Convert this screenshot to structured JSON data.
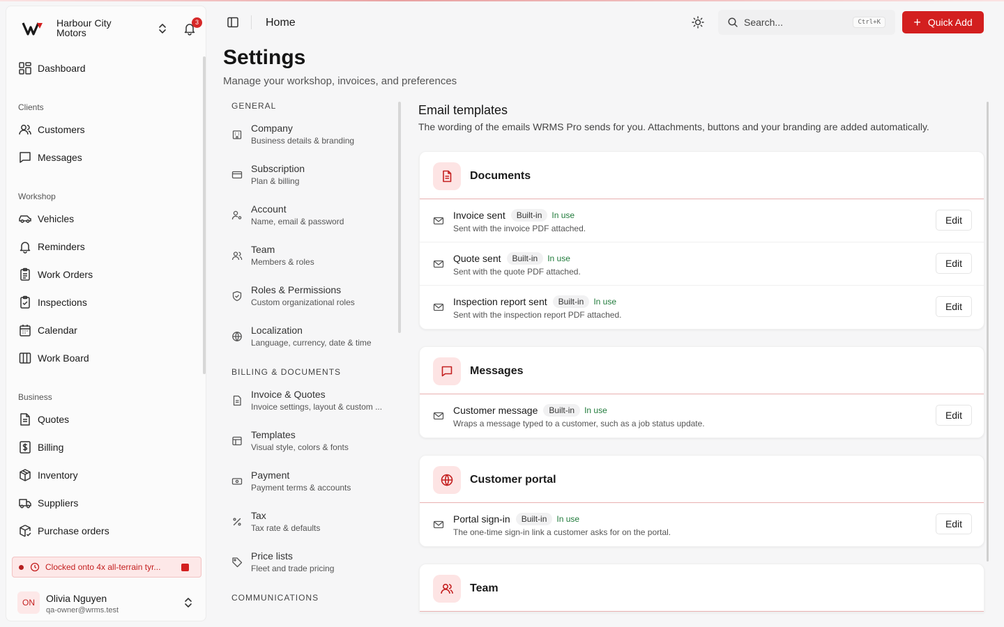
{
  "org": {
    "name": "Harbour City Motors",
    "notification_count": "3"
  },
  "sidebar": {
    "dashboard": "Dashboard",
    "sections": {
      "clients": "Clients",
      "workshop": "Workshop",
      "business": "Business"
    },
    "items": {
      "customers": "Customers",
      "messages": "Messages",
      "vehicles": "Vehicles",
      "reminders": "Reminders",
      "work_orders": "Work Orders",
      "inspections": "Inspections",
      "calendar": "Calendar",
      "work_board": "Work Board",
      "quotes": "Quotes",
      "billing": "Billing",
      "inventory": "Inventory",
      "suppliers": "Suppliers",
      "purchase_orders": "Purchase orders"
    },
    "clocked": "Clocked onto 4x all-terrain tyr...",
    "user": {
      "initials": "ON",
      "name": "Olivia Nguyen",
      "email": "qa-owner@wrms.test"
    }
  },
  "topbar": {
    "breadcrumb": "Home",
    "search_placeholder": "Search...",
    "shortcut": "Ctrl+K",
    "quick_add": "Quick Add"
  },
  "page": {
    "title": "Settings",
    "subtitle": "Manage your workshop, invoices, and preferences"
  },
  "settings_nav": {
    "general_label": "GENERAL",
    "general": [
      {
        "title": "Company",
        "sub": "Business details & branding"
      },
      {
        "title": "Subscription",
        "sub": "Plan & billing"
      },
      {
        "title": "Account",
        "sub": "Name, email & password"
      },
      {
        "title": "Team",
        "sub": "Members & roles"
      },
      {
        "title": "Roles & Permissions",
        "sub": "Custom organizational roles"
      },
      {
        "title": "Localization",
        "sub": "Language, currency, date & time"
      }
    ],
    "billing_label": "BILLING & DOCUMENTS",
    "billing": [
      {
        "title": "Invoice & Quotes",
        "sub": "Invoice settings, layout & custom ..."
      },
      {
        "title": "Templates",
        "sub": "Visual style, colors & fonts"
      },
      {
        "title": "Payment",
        "sub": "Payment terms & accounts"
      },
      {
        "title": "Tax",
        "sub": "Tax rate & defaults"
      },
      {
        "title": "Price lists",
        "sub": "Fleet and trade pricing"
      }
    ],
    "communications_label": "COMMUNICATIONS"
  },
  "email_templates": {
    "title": "Email templates",
    "subtitle": "The wording of the emails WRMS Pro sends for you. Attachments, buttons and your branding are added automatically.",
    "builtin": "Built-in",
    "in_use": "In use",
    "edit": "Edit",
    "groups": {
      "documents": {
        "title": "Documents",
        "rows": [
          {
            "name": "Invoice sent",
            "desc": "Sent with the invoice PDF attached."
          },
          {
            "name": "Quote sent",
            "desc": "Sent with the quote PDF attached."
          },
          {
            "name": "Inspection report sent",
            "desc": "Sent with the inspection report PDF attached."
          }
        ]
      },
      "messages": {
        "title": "Messages",
        "rows": [
          {
            "name": "Customer message",
            "desc": "Wraps a message typed to a customer, such as a job status update."
          }
        ]
      },
      "portal": {
        "title": "Customer portal",
        "rows": [
          {
            "name": "Portal sign-in",
            "desc": "The one-time sign-in link a customer asks for on the portal."
          }
        ]
      },
      "team": {
        "title": "Team"
      }
    }
  },
  "colors": {
    "accent": "#d31f1f",
    "accent_soft": "#fde4e4",
    "in_use": "#1f7a3a"
  }
}
